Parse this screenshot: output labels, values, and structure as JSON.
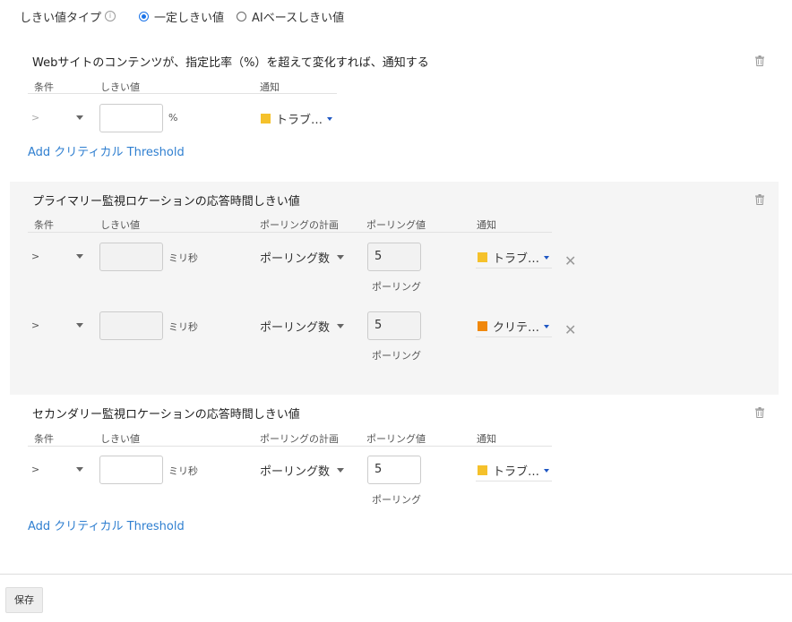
{
  "threshold_type": {
    "label": "しきい値タイプ",
    "info_icon_glyph": "i",
    "options": [
      {
        "label": "一定しきい値",
        "selected": true
      },
      {
        "label": "AIベースしきい値",
        "selected": false
      }
    ]
  },
  "columns": {
    "condition": "条件",
    "threshold": "しきい値",
    "poll_plan": "ポーリングの計画",
    "poll_value": "ポーリング値",
    "notify": "通知"
  },
  "sections": [
    {
      "title": "Webサイトのコンテンツが、指定比率（%）を超えて変化すれば、通知する",
      "rows": [
        {
          "condition": ">",
          "threshold_value": "",
          "unit": "%",
          "notify_label": "トラブ…",
          "notify_color": "#f5c12b"
        }
      ],
      "add_link": "Add クリティカル Threshold"
    },
    {
      "title": "プライマリー監視ロケーションの応答時間しきい値",
      "rows": [
        {
          "condition": ">",
          "threshold_value": "",
          "unit": "ミリ秒",
          "poll_plan": "ポーリング数",
          "poll_value": "5",
          "poll_caption": "ポーリング",
          "notify_label": "トラブ…",
          "notify_color": "#f5c12b",
          "remove_glyph": "✕"
        },
        {
          "condition": ">",
          "threshold_value": "",
          "unit": "ミリ秒",
          "poll_plan": "ポーリング数",
          "poll_value": "5",
          "poll_caption": "ポーリング",
          "notify_label": "クリテ…",
          "notify_color": "#f0880c",
          "remove_glyph": "✕"
        }
      ]
    },
    {
      "title": "セカンダリー監視ロケーションの応答時間しきい値",
      "rows": [
        {
          "condition": ">",
          "threshold_value": "",
          "unit": "ミリ秒",
          "poll_plan": "ポーリング数",
          "poll_value": "5",
          "poll_caption": "ポーリング",
          "notify_label": "トラブ…",
          "notify_color": "#f5c12b"
        }
      ],
      "add_link": "Add クリティカル Threshold"
    }
  ],
  "footer": {
    "save_label": "保存"
  },
  "colors": {
    "accent": "#1a73e8",
    "link": "#2f7fd0",
    "trouble": "#f5c12b",
    "critical": "#f0880c"
  }
}
